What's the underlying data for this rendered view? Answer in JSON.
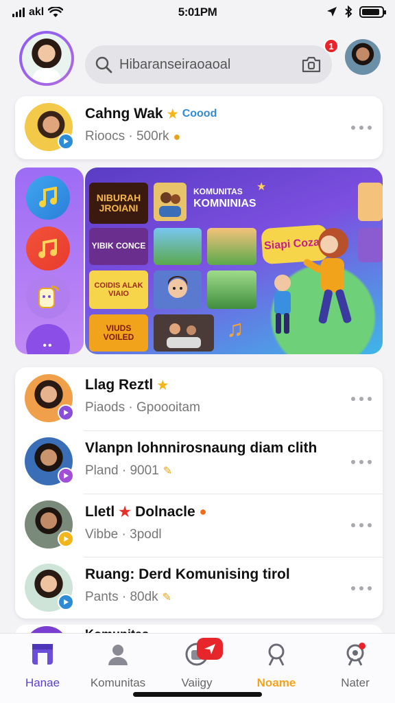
{
  "status_bar": {
    "carrier": "akl",
    "time": "5:01PM",
    "battery_level": 0.9
  },
  "header": {
    "search_placeholder": "Hibaranseiraoaoal",
    "notification_count": "1"
  },
  "top_channel": {
    "title": "Cahng Wak",
    "tag": "Coood",
    "subtitle": "Rioocs · 500rk"
  },
  "channels": [
    {
      "title": "Llag Reztl",
      "subtitle": "Piaods · Gpoooitam",
      "badge_color": "#8a4fd8"
    },
    {
      "title": "Vlanpn lohnnirosnaung diam clith",
      "subtitle": "Pland · 9001",
      "badge_color": "#a24fd8"
    },
    {
      "title": "Lletl",
      "title_suffix": "Dolnacle",
      "subtitle": "Vibbe · 3podl",
      "badge_color": "#f2b51c"
    },
    {
      "title": "Ruang: Derd Komunising tirol",
      "subtitle": "Pants · 80dk",
      "badge_color": "#2e8bd6"
    }
  ],
  "next_card_peek": "Komunitas",
  "banner": {
    "title_small": "KOMUNITAS",
    "title_big": "KOMNINIAS",
    "tiles": [
      "NIBURAH JROIANI",
      "YIBIK CONCE",
      "COIDIS ALAK VIAIO",
      "VIUDS VOILED",
      "Siapi Cozay"
    ]
  },
  "nav": {
    "items": [
      {
        "label": "Hanae",
        "active": true
      },
      {
        "label": "Komunitas",
        "active": false
      },
      {
        "label": "Vaiigy",
        "active": false
      },
      {
        "label": "Noame",
        "active": false,
        "highlight": true
      },
      {
        "label": "Nater",
        "active": false
      }
    ]
  },
  "colors": {
    "accent": "#6b4fd8",
    "brand_purple": "#9d6cf5",
    "alert_red": "#e8242a",
    "highlight_orange": "#f2a31c"
  }
}
